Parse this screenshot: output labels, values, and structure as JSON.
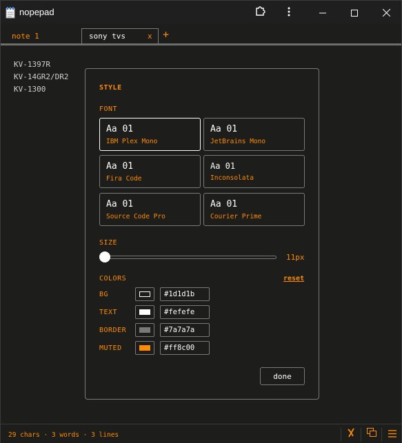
{
  "window": {
    "title": "nopepad"
  },
  "tabs": [
    {
      "label": "note 1"
    },
    {
      "label": "sony tvs",
      "close": "x"
    }
  ],
  "tab_add": "+",
  "editor": {
    "lines": [
      "KV-1397R",
      "KV-14GR2/DR2",
      "KV-1300"
    ]
  },
  "modal": {
    "title": "STYLE",
    "font_label": "FONT",
    "fonts": [
      {
        "sample": "Aa 01",
        "name": "IBM Plex Mono",
        "selected": true
      },
      {
        "sample": "Aa 01",
        "name": "JetBrains Mono"
      },
      {
        "sample": "Aa 01",
        "name": "Fira Code"
      },
      {
        "sample": "Aa 01",
        "name": "Inconsolata"
      },
      {
        "sample": "Aa 01",
        "name": "Source Code Pro"
      },
      {
        "sample": "Aa 01",
        "name": "Courier Prime"
      }
    ],
    "size_label": "SIZE",
    "size_value": "11px",
    "colors_label": "COLORS",
    "reset_label": "reset",
    "colors": [
      {
        "label": "BG",
        "value": "#1d1d1b"
      },
      {
        "label": "TEXT",
        "value": "#fefefe"
      },
      {
        "label": "BORDER",
        "value": "#7a7a7a"
      },
      {
        "label": "MUTED",
        "value": "#ff8c00"
      }
    ],
    "done_label": "done"
  },
  "status": {
    "text": "29 chars · 3 words · 3 lines"
  },
  "theme": {
    "accent": "#ff8c00",
    "bg": "#1d1d1b",
    "text": "#fefefe",
    "border": "#7a7a7a"
  },
  "icons": [
    "notepad-icon",
    "extension-icon",
    "more-vertical-icon",
    "minimize-icon",
    "maximize-icon",
    "close-icon",
    "spellcheck-off-icon",
    "copy-icon",
    "menu-icon"
  ]
}
